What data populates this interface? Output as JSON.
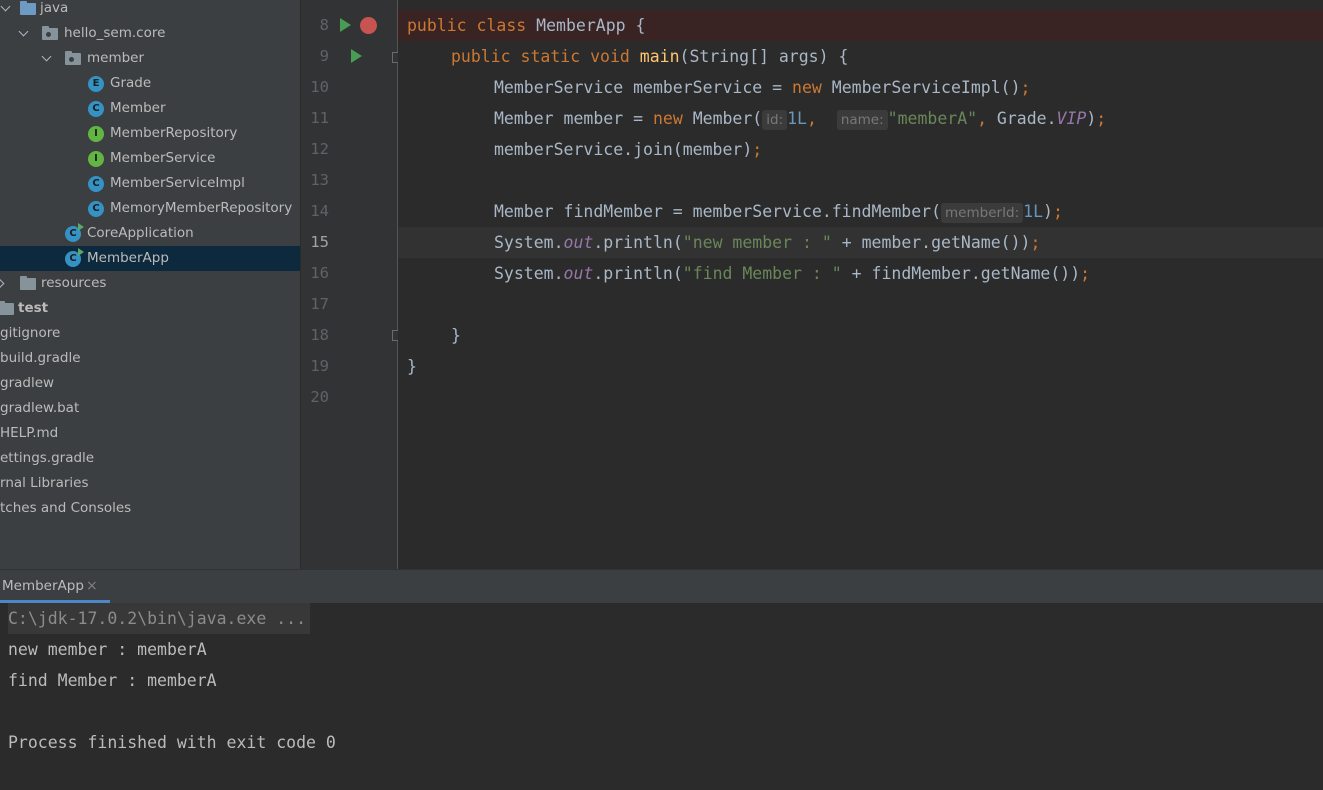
{
  "project_tree": {
    "items": [
      {
        "label": "java",
        "kind": "folder-blue"
      },
      {
        "label": "hello_sem.core",
        "kind": "package"
      },
      {
        "label": "member",
        "kind": "package"
      },
      {
        "label": "Grade",
        "kind": "enum",
        "badge": "E"
      },
      {
        "label": "Member",
        "kind": "class",
        "badge": "C"
      },
      {
        "label": "MemberRepository",
        "kind": "interface",
        "badge": "I"
      },
      {
        "label": "MemberService",
        "kind": "interface",
        "badge": "I"
      },
      {
        "label": "MemberServiceImpl",
        "kind": "class",
        "badge": "C"
      },
      {
        "label": "MemoryMemberRepository",
        "kind": "class",
        "badge": "C"
      },
      {
        "label": "CoreApplication",
        "kind": "runnable-class",
        "badge": "C"
      },
      {
        "label": "MemberApp",
        "kind": "runnable-class",
        "badge": "C",
        "selected": true
      },
      {
        "label": "resources",
        "kind": "folder"
      },
      {
        "label": "test",
        "kind": "folder"
      },
      {
        "label": "gitignore",
        "kind": "file"
      },
      {
        "label": "build.gradle",
        "kind": "file"
      },
      {
        "label": "gradlew",
        "kind": "file"
      },
      {
        "label": "gradlew.bat",
        "kind": "file"
      },
      {
        "label": "HELP.md",
        "kind": "file"
      },
      {
        "label": "ettings.gradle",
        "kind": "file"
      },
      {
        "label": "rnal Libraries",
        "kind": "libs"
      },
      {
        "label": "tches and Consoles",
        "kind": "scratches"
      }
    ]
  },
  "editor": {
    "line_numbers": [
      "8",
      "9",
      "10",
      "11",
      "12",
      "13",
      "14",
      "15",
      "16",
      "17",
      "18",
      "19",
      "20"
    ],
    "current_line": "15",
    "code": {
      "l8_kw1": "public",
      "l8_kw2": "class",
      "l8_rest": " MemberApp {",
      "l9_kw1": "public",
      "l9_kw2": "static",
      "l9_kw3": "void",
      "l9_fn": "main",
      "l9_rest": "(String[] args) {",
      "l10_a": "MemberService memberService = ",
      "l10_kw": "new",
      "l10_b": " MemberServiceImpl()",
      "l10_semi": ";",
      "l11_a": "Member member = ",
      "l11_kw": "new",
      "l11_b": " Member(",
      "l11_hint1": "id:",
      "l11_num": "1L",
      "l11_comma1": ",",
      "l11_hint2": "name:",
      "l11_str": "\"memberA\"",
      "l11_comma2": ",",
      "l11_c": " Grade.",
      "l11_static": "VIP",
      "l11_d": ")",
      "l11_semi": ";",
      "l12_a": "memberService.join(member)",
      "l12_semi": ";",
      "l14_a": "Member findMember = memberService.findMember(",
      "l14_hint": "memberId:",
      "l14_num": "1L",
      "l14_b": ")",
      "l14_semi": ";",
      "l15_a": "System.",
      "l15_static": "out",
      "l15_b": ".println(",
      "l15_str": "\"new member : \"",
      "l15_c": " + member.getName())",
      "l15_semi": ";",
      "l16_a": "System.",
      "l16_static": "out",
      "l16_b": ".println(",
      "l16_str": "\"find Member : \"",
      "l16_c": " + findMember.getName())",
      "l16_semi": ";",
      "l18": "}",
      "l19": "}"
    }
  },
  "run_window": {
    "tab_label": "MemberApp",
    "close_glyph": "×",
    "console_lines": [
      "C:\\jdk-17.0.2\\bin\\java.exe ...",
      "new member : memberA",
      "find Member : memberA",
      "",
      "Process finished with exit code 0"
    ]
  }
}
